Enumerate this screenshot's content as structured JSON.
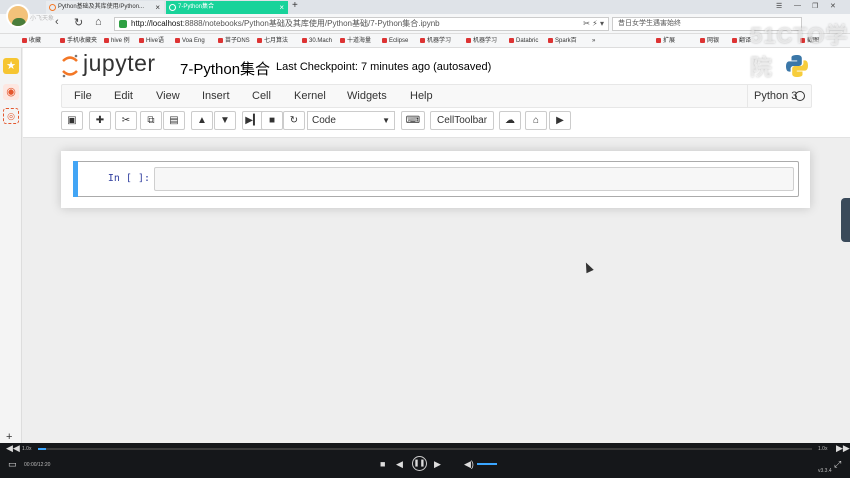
{
  "browser": {
    "avatar_name": "小飞天象",
    "tabs": [
      {
        "label": "Python基础及其库使用/Python...",
        "active": false
      },
      {
        "label": "7-Python集合",
        "active": true
      }
    ],
    "url_host": "http://localhost",
    "url_rest": ":8888/notebooks/Python基础及其库使用/Python基础/7-Python集合.ipynb",
    "search_text": "昔日女学生遇害始终",
    "bookmarks": [
      "收藏",
      "手机收藏夹",
      "hive 例",
      "Hive语",
      "Voa Eng",
      "苗子DNS",
      "七月算法",
      "30.Mach",
      "十道海量",
      "Eclipse",
      "机器学习",
      "机器学习",
      "Databric",
      "Spark百",
      "»",
      "扩展",
      "网银",
      "翻译",
      "截图"
    ],
    "window_controls": [
      "☰",
      "—",
      "❐",
      "✕"
    ]
  },
  "jupyter": {
    "logo_text": "jupyter",
    "notebook_name": "7-Python集合",
    "checkpoint": "Last Checkpoint: 7 minutes ago (autosaved)",
    "menu": [
      "File",
      "Edit",
      "View",
      "Insert",
      "Cell",
      "Kernel",
      "Widgets",
      "Help"
    ],
    "kernel": "Python 3",
    "cell_type": "Code",
    "celltoolbar_label": "CellToolbar",
    "prompt": "In [ ]:"
  },
  "player": {
    "speed_left": "1.0x",
    "speed_right": "1.0x",
    "time": "00:00/12:20",
    "version": "v3.3.4",
    "progress": 0.01
  },
  "watermark": "51CTO学院",
  "colors": {
    "active_tab": "#18d39a",
    "cell_selected_bar": "#42a5f5",
    "jupyter_orange": "#f37726",
    "prompt_blue": "#303f9f",
    "player_accent": "#3ba6ff"
  }
}
